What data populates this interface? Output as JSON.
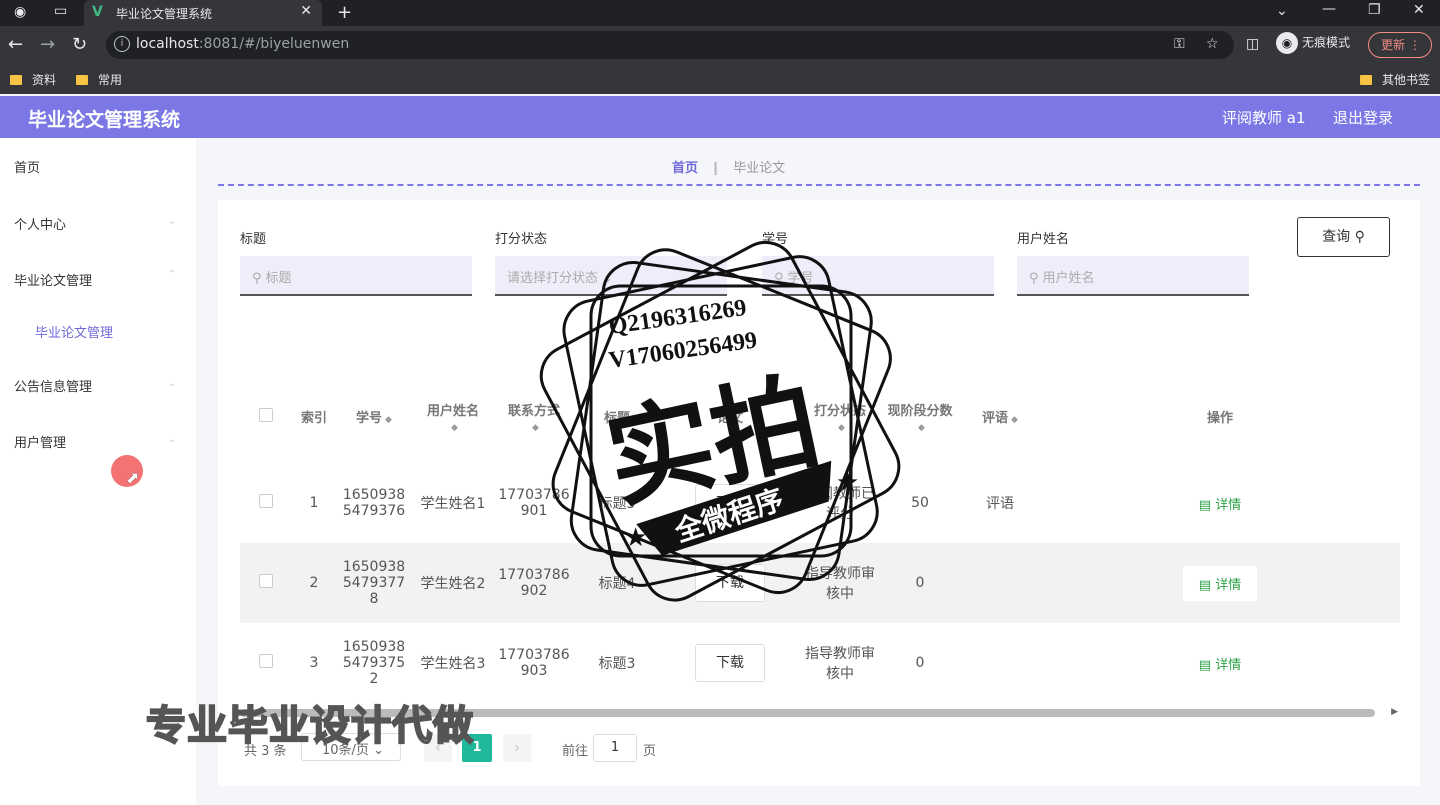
{
  "browser": {
    "tab_title": "毕业论文管理系统",
    "tab_icon": "V",
    "url_host": "localhost",
    "url_rest": ":8081/#/biyeluenwen",
    "profile_label": "无痕模式",
    "update_label": "更新",
    "bookmarks": [
      "资料",
      "常用"
    ],
    "other_bookmarks": "其他书签"
  },
  "header": {
    "title": "毕业论文管理系统",
    "user": "评阅教师 a1",
    "logout": "退出登录"
  },
  "sidebar": {
    "items": [
      {
        "label": "首页"
      },
      {
        "label": "个人中心"
      },
      {
        "label": "毕业论文管理"
      },
      {
        "label": "毕业论文管理"
      },
      {
        "label": "公告信息管理"
      },
      {
        "label": "用户管理"
      }
    ]
  },
  "breadcrumb": {
    "home": "首页",
    "current": "毕业论文"
  },
  "search": {
    "fields": [
      {
        "label": "标题",
        "placeholder": "标题"
      },
      {
        "label": "打分状态",
        "placeholder": "请选择打分状态"
      },
      {
        "label": "学号",
        "placeholder": "学号"
      },
      {
        "label": "用户姓名",
        "placeholder": "用户姓名"
      }
    ],
    "button": "查询"
  },
  "table": {
    "headers": [
      "索引",
      "学号",
      "用户姓名",
      "联系方式",
      "标题",
      "论文",
      "打分状态",
      "现阶段分数",
      "评语",
      "操作"
    ],
    "rows": [
      {
        "index": "1",
        "student_id": "16509385479376",
        "name": "学生姓名1",
        "phone": "17703786901",
        "title": "标题5",
        "file": "",
        "status": "评阅教师已评分",
        "score": "50",
        "comment": "评语",
        "action": "详情"
      },
      {
        "index": "2",
        "student_id": "16509385479377 8",
        "name": "学生姓名2",
        "phone": "17703786902",
        "title": "标题4",
        "file": "下载",
        "status": "指导教师审核中",
        "score": "0",
        "comment": "",
        "action": "详情"
      },
      {
        "index": "3",
        "student_id": "16509385479375 2",
        "name": "学生姓名3",
        "phone": "17703786903",
        "title": "标题3",
        "file": "下载",
        "status": "指导教师审核中",
        "score": "0",
        "comment": "",
        "action": "详情"
      }
    ]
  },
  "pagination": {
    "total": "共 3 条",
    "page_size": "10条/页",
    "current_page": "1",
    "jump_label": "前往",
    "jump_value": "1",
    "page_unit": "页"
  },
  "watermark": {
    "line1": "Q2196316269",
    "line2": "V17060256499",
    "big": "实拍",
    "banner": "全微程序"
  },
  "promo_text": "专业毕业设计代做",
  "colors": {
    "header": "#7b78e6",
    "accent": "#6f6ad8",
    "success": "#1fb89a",
    "link": "#2aa147"
  }
}
